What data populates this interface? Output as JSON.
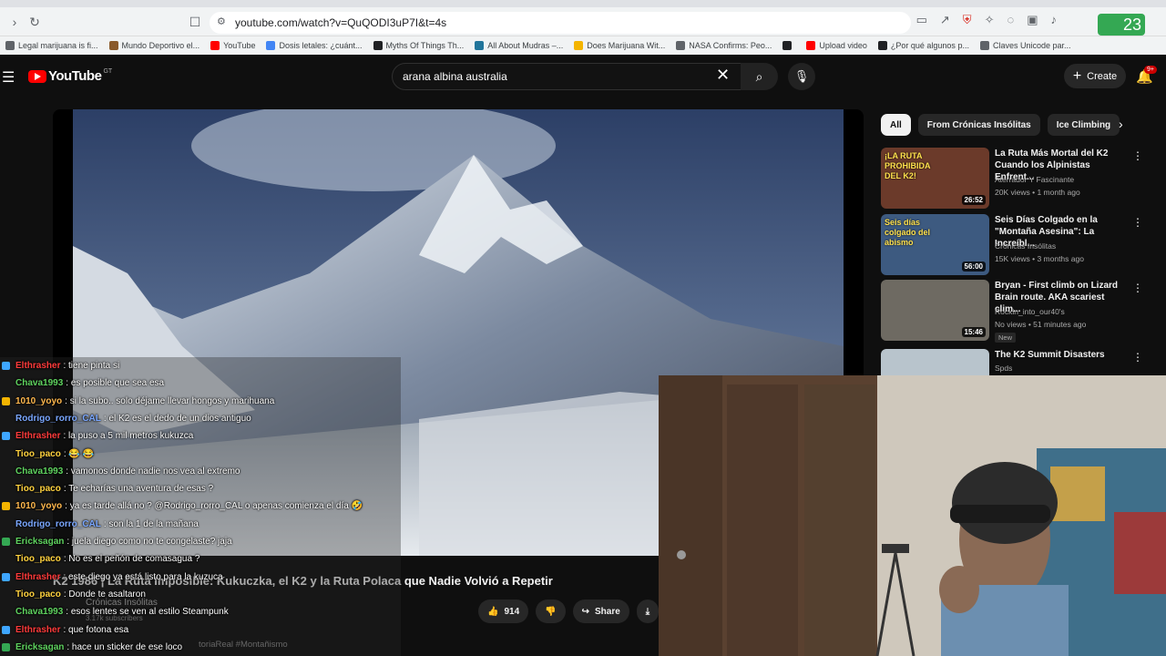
{
  "browser": {
    "url": "youtube.com/watch?v=QuQODI3uP7I&t=4s",
    "extension_badge": "23",
    "bookmarks": [
      {
        "label": "Legal marijuana is fi...",
        "color": "#5f6368"
      },
      {
        "label": "Mundo Deportivo el...",
        "color": "#8a5a2b"
      },
      {
        "label": "YouTube",
        "color": "#ff0000"
      },
      {
        "label": "Dosis letales: ¿cuánt...",
        "color": "#4285f4"
      },
      {
        "label": "Myths Of Things Th...",
        "color": "#202124"
      },
      {
        "label": "All About Mudras –...",
        "color": "#21759b"
      },
      {
        "label": "Does Marijuana Wit...",
        "color": "#f4b400"
      },
      {
        "label": "NASA Confirms: Peo...",
        "color": "#5f6368"
      },
      {
        "label": "",
        "color": "#202124"
      },
      {
        "label": "Upload video",
        "color": "#ff0000"
      },
      {
        "label": "¿Por qué algunos p...",
        "color": "#202124"
      },
      {
        "label": "Claves Unicode par...",
        "color": "#5f6368"
      }
    ]
  },
  "header": {
    "logo_text": "YouTube",
    "region": "GT",
    "search_query": "arana albina australia",
    "create_label": "Create",
    "notif_count": "9+"
  },
  "chips": [
    "All",
    "From Crónicas Insólitas",
    "Ice Climbing"
  ],
  "recommendations": [
    {
      "title": "La Ruta Más Mortal del K2 Cuando los Alpinistas Enfrent...",
      "channel": "Aterrador Y Fascinante",
      "meta": "20K views • 1 month ago",
      "duration": "26:52",
      "thumb_text": "¡LA RUTA PROHIBIDA DEL K2!",
      "thumb_color": "#6b3a2a",
      "new": ""
    },
    {
      "title": "Seis Días Colgado en la \"Montaña Asesina\": La Increíbl...",
      "channel": "Crónicas Insólitas",
      "meta": "15K views • 3 months ago",
      "duration": "56:00",
      "thumb_text": "Seis días colgado del abismo",
      "thumb_color": "#3d5a80",
      "new": ""
    },
    {
      "title": "Bryan - First climb on Lizard Brain route. AKA scariest clim...",
      "channel": "Rockin_into_our40's",
      "meta": "No views • 51 minutes ago",
      "duration": "15:46",
      "thumb_text": "",
      "thumb_color": "#6e6a62",
      "new": "New"
    },
    {
      "title": "The K2 Summit Disasters",
      "channel": "Spds",
      "meta": "",
      "duration": "",
      "thumb_text": "",
      "thumb_color": "#b8c4cc",
      "new": ""
    }
  ],
  "video": {
    "title": "K2 1986 | La Ruta Imposible: Kukuczka, el K2 y la Ruta Polaca que Nadie Volvió a Repetir",
    "channel": "Crónicas Insólitas",
    "subscribers": "3.17k subscribers",
    "likes": "914",
    "share_label": "Share",
    "desc_snippet": "toriaReal #Montañismo"
  },
  "chat": [
    {
      "user": "Elthrasher",
      "text": ": tiene pinta si",
      "color": "#ff3b3b",
      "badge": "#3ea6ff"
    },
    {
      "user": "Chava1993",
      "text": ": es posible que sea esa",
      "color": "#5fd35f",
      "badge": ""
    },
    {
      "user": "1010_yoyo",
      "text": ": si la subo.. solo déjame llevar hongos y marihuana",
      "color": "#ffb84d",
      "badge": "#f4b400"
    },
    {
      "user": "Rodrigo_rorro_CAL",
      "text": ": el K2 es el dedo de un dios antiguo",
      "color": "#7aa7ff",
      "badge": ""
    },
    {
      "user": "Elthrasher",
      "text": ": la puso a 5 mil metros kukuzca",
      "color": "#ff3b3b",
      "badge": "#3ea6ff"
    },
    {
      "user": "Tioo_paco",
      "text": ": 😂 😂",
      "color": "#ffd23f",
      "badge": ""
    },
    {
      "user": "Chava1993",
      "text": ": vamonos donde nadie nos vea al extremo",
      "color": "#5fd35f",
      "badge": ""
    },
    {
      "user": "Tioo_paco",
      "text": ": Te echarías una aventura de esas ?",
      "color": "#ffd23f",
      "badge": ""
    },
    {
      "user": "1010_yoyo",
      "text": ": ya es tarde allá no ? @Rodrigo_rorro_CAL o apenas comienza el día 🤣",
      "color": "#ffb84d",
      "badge": "#f4b400"
    },
    {
      "user": "Rodrigo_rorro_CAL",
      "text": ": son la 1 de la mañana",
      "color": "#7aa7ff",
      "badge": ""
    },
    {
      "user": "Ericksagan",
      "text": ": juela diego como no te congelaste? jaja",
      "color": "#5fd35f",
      "badge": "#34a853"
    },
    {
      "user": "Tioo_paco",
      "text": ": No es el peñón de comasagua ?",
      "color": "#ffd23f",
      "badge": ""
    },
    {
      "user": "Elthrasher",
      "text": ": este diego ya está listo para la kuzuca",
      "color": "#ff3b3b",
      "badge": "#3ea6ff"
    },
    {
      "user": "Tioo_paco",
      "text": ": Donde te asaltaron",
      "color": "#ffd23f",
      "badge": ""
    },
    {
      "user": "Chava1993",
      "text": ": esos lentes se ven al estilo Steampunk",
      "color": "#5fd35f",
      "badge": ""
    },
    {
      "user": "Elthrasher",
      "text": ": que fotona esa",
      "color": "#ff3b3b",
      "badge": "#3ea6ff"
    },
    {
      "user": "Ericksagan",
      "text": ": hace un sticker de ese loco",
      "color": "#5fd35f",
      "badge": "#34a853"
    }
  ]
}
